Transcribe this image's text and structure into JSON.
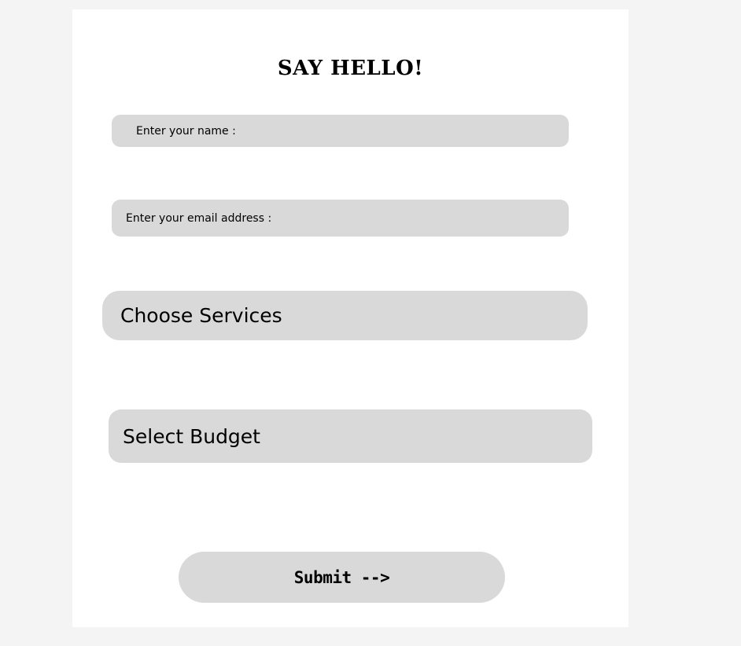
{
  "form": {
    "title": "SAY HELLO!",
    "name_placeholder": "Enter your name :",
    "email_placeholder": "Enter your email address :",
    "services_label": "Choose Services",
    "budget_label": "Select Budget",
    "submit_label": "Submit -->"
  },
  "colors": {
    "page_background": "#f4f4f4",
    "card_background": "#ffffff",
    "field_background": "#d9d9d9",
    "text": "#000000"
  }
}
